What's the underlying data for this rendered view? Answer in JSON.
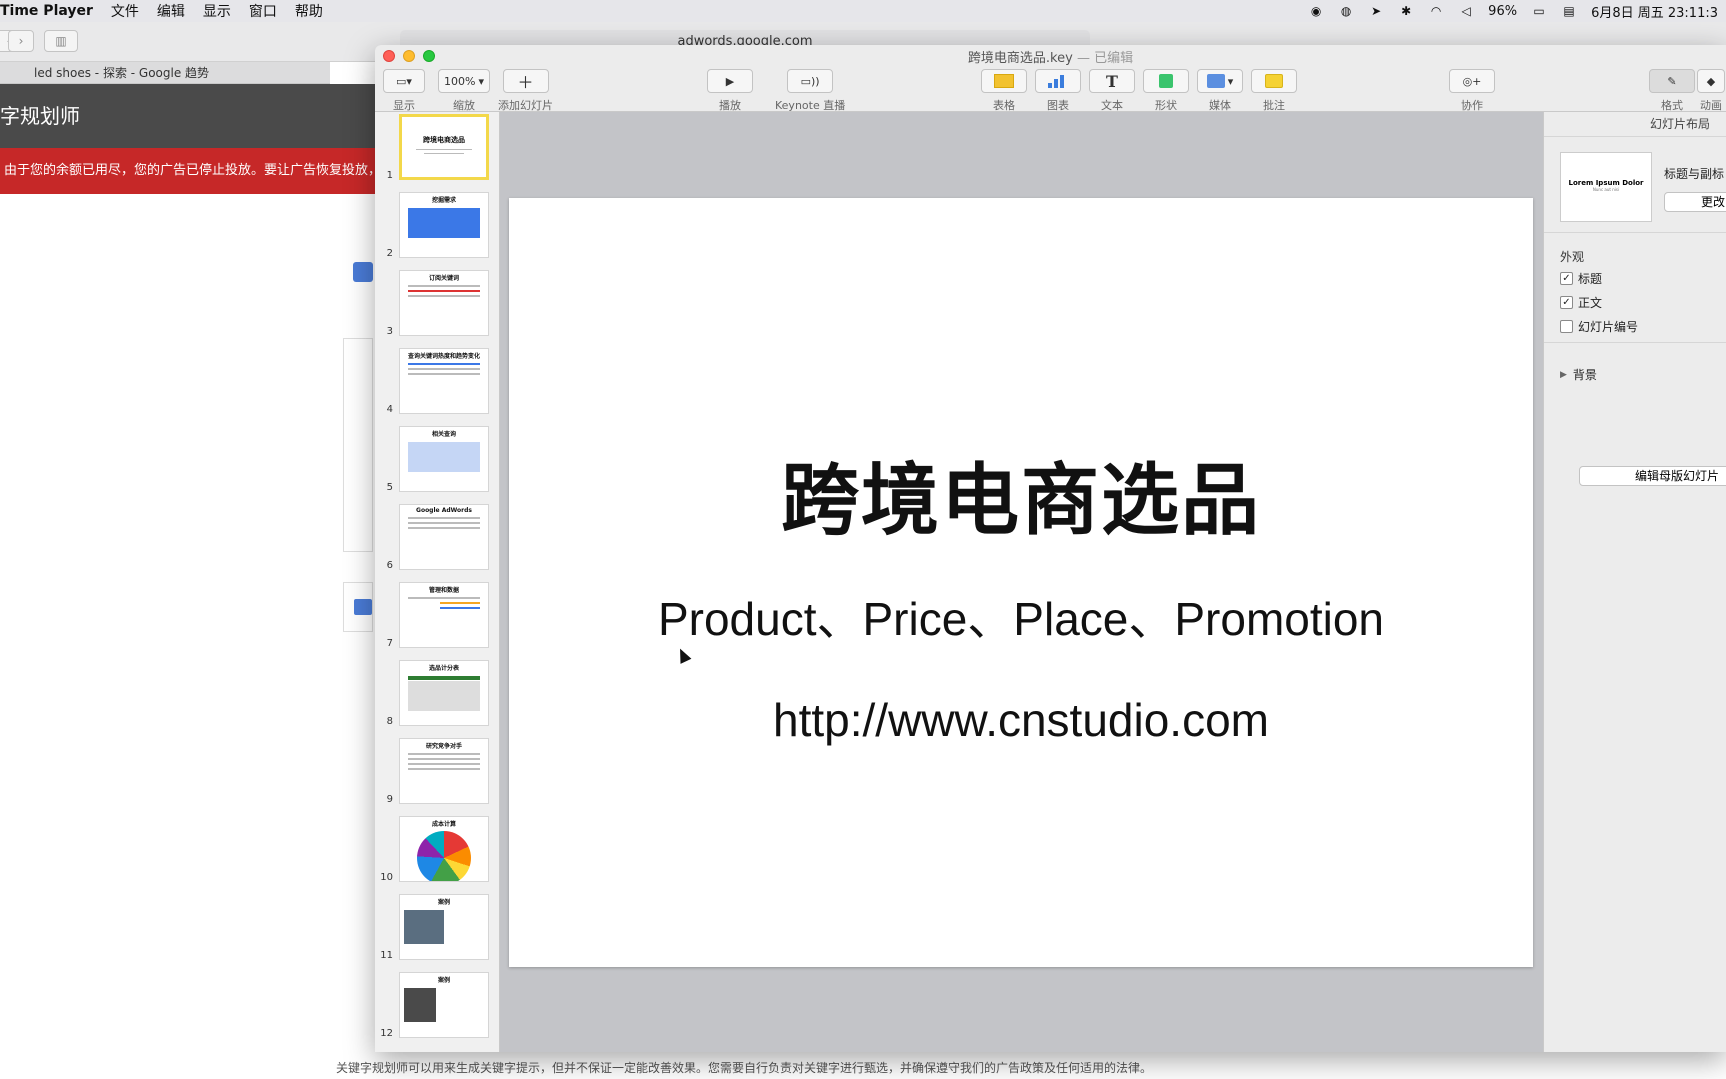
{
  "menubar": {
    "app": "Time Player",
    "items": [
      "文件",
      "编辑",
      "显示",
      "窗口",
      "帮助"
    ],
    "battery": "96%",
    "datetime": "6月8日 周五  23:11:3"
  },
  "browser": {
    "url": "adwords.google.com",
    "tab": "led shoes - 探索 - Google 趋势",
    "header": "字规划师",
    "alert": "由于您的余额已用尽，您的广告已停止投放。要让广告恢复投放，",
    "footer": "关键字规划师可以用来生成关键字提示，但并不保证一定能改善效果。您需要自行负责对关键字进行甄选，并确保遵守我们的广告政策及任何适用的法律。"
  },
  "keynote": {
    "title": "跨境电商选品.key",
    "edited": "— 已编辑",
    "toolbar": {
      "view": "显示",
      "zoom_value": "100%",
      "zoom": "缩放",
      "add_slide": "添加幻灯片",
      "play": "播放",
      "live": "Keynote 直播",
      "table": "表格",
      "chart": "图表",
      "text": "文本",
      "shape": "形状",
      "media": "媒体",
      "comment": "批注",
      "collab": "协作",
      "format": "格式",
      "animate": "动画"
    },
    "thumbnails": [
      {
        "num": "1",
        "title": "跨境电商选品"
      },
      {
        "num": "2",
        "title": "挖掘需求"
      },
      {
        "num": "3",
        "title": "订阅关键词"
      },
      {
        "num": "4",
        "title": "查询关键词热度和趋势变化"
      },
      {
        "num": "5",
        "title": "相关查询"
      },
      {
        "num": "6",
        "title": "Google AdWords"
      },
      {
        "num": "7",
        "title": "管理和数据"
      },
      {
        "num": "8",
        "title": "选品计分表"
      },
      {
        "num": "9",
        "title": "研究竞争对手"
      },
      {
        "num": "10",
        "title": "成本计算"
      },
      {
        "num": "11",
        "title": "案例"
      },
      {
        "num": "12",
        "title": "案例"
      }
    ],
    "slide": {
      "title": "跨境电商选品",
      "subtitle": "Product、Price、Place、Promotion",
      "url": "http://www.cnstudio.com"
    },
    "inspector": {
      "header": "幻灯片布局",
      "layout_thumb_title": "Lorem Ipsum Dolor",
      "layout_thumb_sub": "Nunc aut nisi",
      "layout_name": "标题与副标",
      "change": "更改",
      "appearance": "外观",
      "opt_title": "标题",
      "opt_body": "正文",
      "opt_number": "幻灯片编号",
      "background": "背景",
      "edit_master": "编辑母版幻灯片"
    }
  }
}
